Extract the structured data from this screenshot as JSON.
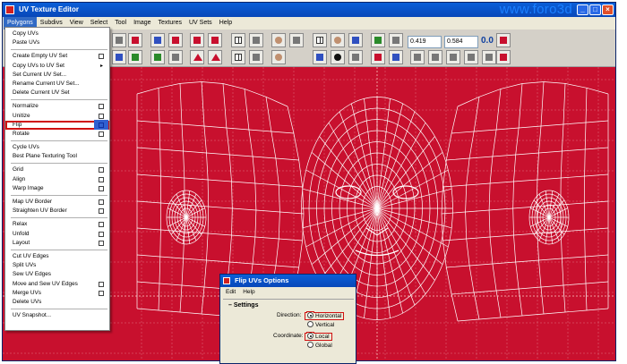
{
  "window": {
    "title": "UV Texture Editor",
    "watermark": "www.foro3d"
  },
  "menubar": {
    "items": [
      "Polygons",
      "Subdivs",
      "View",
      "Select",
      "Tool",
      "Image",
      "Textures",
      "UV Sets",
      "Help"
    ]
  },
  "toolbar": {
    "u_value": "0.419",
    "v_value": "0.584",
    "zoom_label": "0.0"
  },
  "polygons_menu": {
    "groups": [
      [
        {
          "label": "Copy UVs"
        },
        {
          "label": "Paste UVs"
        }
      ],
      [
        {
          "label": "Create Empty UV Set",
          "option": true
        },
        {
          "label": "Copy UVs to UV Set",
          "submenu": true
        },
        {
          "label": "Set Current UV Set..."
        },
        {
          "label": "Rename Current UV Set..."
        },
        {
          "label": "Delete Current UV Set"
        }
      ],
      [
        {
          "label": "Normalize",
          "option": true
        },
        {
          "label": "Unitize",
          "option": true
        },
        {
          "label": "Flip",
          "option": true,
          "highlight": true
        },
        {
          "label": "Rotate",
          "option": true
        }
      ],
      [
        {
          "label": "Cycle UVs"
        },
        {
          "label": "Best Plane Texturing Tool"
        }
      ],
      [
        {
          "label": "Grid",
          "option": true
        },
        {
          "label": "Align",
          "option": true
        },
        {
          "label": "Warp Image",
          "option": true
        }
      ],
      [
        {
          "label": "Map UV Border",
          "option": true
        },
        {
          "label": "Straighten UV Border",
          "option": true
        }
      ],
      [
        {
          "label": "Relax",
          "option": true
        },
        {
          "label": "Unfold",
          "option": true
        },
        {
          "label": "Layout",
          "option": true
        }
      ],
      [
        {
          "label": "Cut UV Edges"
        },
        {
          "label": "Split UVs"
        },
        {
          "label": "Sew UV Edges"
        },
        {
          "label": "Move and Sew UV Edges",
          "option": true
        },
        {
          "label": "Merge UVs",
          "option": true
        },
        {
          "label": "Delete UVs"
        }
      ],
      [
        {
          "label": "UV Snapshot..."
        }
      ]
    ]
  },
  "flip_dialog": {
    "title": "Flip UVs Options",
    "menu": [
      "Edit",
      "Help"
    ],
    "section": "Settings",
    "direction_label": "Direction:",
    "direction_options": [
      "Horizontal",
      "Vertical"
    ],
    "direction_selected": "Horizontal",
    "coordinate_label": "Coordinate:",
    "coordinate_options": [
      "Local",
      "Global"
    ],
    "coordinate_selected": "Local"
  },
  "colors": {
    "viewport": "#c8102e",
    "highlight": "#d01010",
    "titlebar": "#0a5fd8"
  }
}
